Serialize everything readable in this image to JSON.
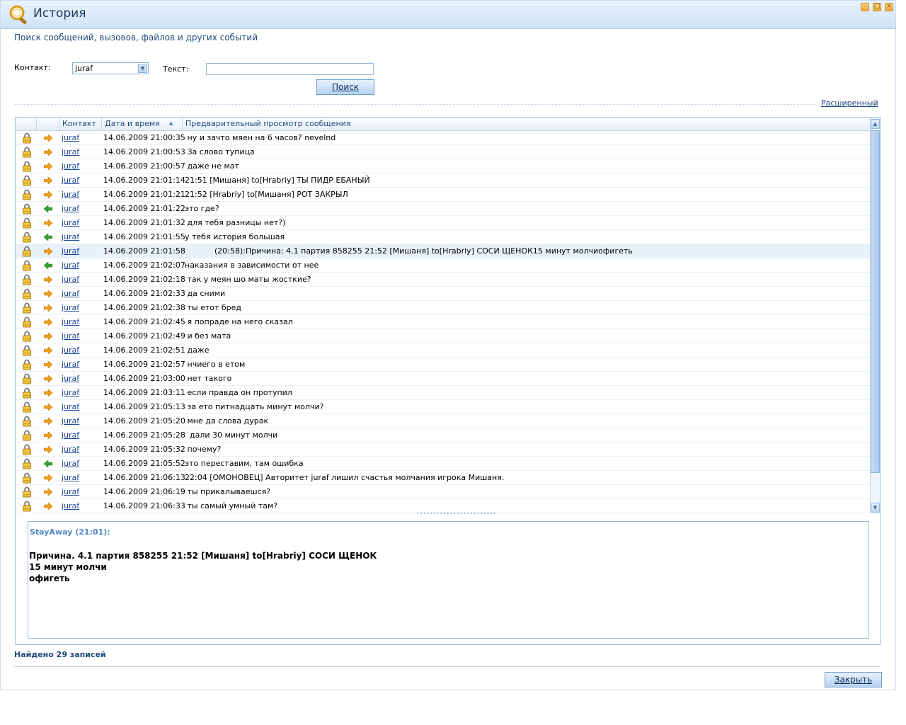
{
  "window": {
    "title": "История"
  },
  "search": {
    "subtitle": "Поиск сообщений, вызовов, файлов и других событий",
    "contact_label": "Контакт:",
    "contact_value": "juraf",
    "text_label": "Текст:",
    "text_value": "",
    "search_button": "Поиск",
    "advanced_link": "Расширенный"
  },
  "table": {
    "columns": [
      "",
      "",
      "Контакт",
      "Дата и время",
      "Предварительный просмотр сообщения"
    ],
    "rows": [
      {
        "dir": "out",
        "contact": "juraf",
        "date": "14.06.2009 21:00:35",
        "msg": " ну и зачто мяен на 6 часов? nevelnd"
      },
      {
        "dir": "out",
        "contact": "juraf",
        "date": "14.06.2009 21:00:53",
        "msg": " За слово тупица"
      },
      {
        "dir": "out",
        "contact": "juraf",
        "date": "14.06.2009 21:00:57",
        "msg": " даже не мат"
      },
      {
        "dir": "out",
        "contact": "juraf",
        "date": "14.06.2009 21:01:14",
        "msg": "21:51 [Мишаня] to[Hrabriy] ТЫ ПИДР ЕБАНЫЙ"
      },
      {
        "dir": "out",
        "contact": "juraf",
        "date": "14.06.2009 21:01:21",
        "msg": "21:52 [Hrabriy] to[Мишаня] РОТ ЗАКРЫЛ"
      },
      {
        "dir": "in",
        "contact": "juraf",
        "date": "14.06.2009 21:01:22",
        "msg": "это где?"
      },
      {
        "dir": "out",
        "contact": "juraf",
        "date": "14.06.2009 21:01:32",
        "msg": " для тебя разницы нет?)"
      },
      {
        "dir": "in",
        "contact": "juraf",
        "date": "14.06.2009 21:01:55",
        "msg": "у тебя история большая"
      },
      {
        "dir": "out",
        "contact": "juraf",
        "date": "14.06.2009 21:01:58",
        "msg": "            (20:58):Причина: 4.1 партия 858255 21:52 [Мишаня] to[Hrabriy] СОСИ ЩЕНОК15 минут молчиофигеть",
        "selected": true
      },
      {
        "dir": "in",
        "contact": "juraf",
        "date": "14.06.2009 21:02:07",
        "msg": "наказания в зависимости от нее"
      },
      {
        "dir": "out",
        "contact": "juraf",
        "date": "14.06.2009 21:02:18",
        "msg": " так у меян шо маты жосткие?"
      },
      {
        "dir": "out",
        "contact": "juraf",
        "date": "14.06.2009 21:02:33",
        "msg": " да сними"
      },
      {
        "dir": "out",
        "contact": "juraf",
        "date": "14.06.2009 21:02:38",
        "msg": " ты етот бред"
      },
      {
        "dir": "out",
        "contact": "juraf",
        "date": "14.06.2009 21:02:45",
        "msg": " я попраде на него сказал"
      },
      {
        "dir": "out",
        "contact": "juraf",
        "date": "14.06.2009 21:02:49",
        "msg": " и без мата"
      },
      {
        "dir": "out",
        "contact": "juraf",
        "date": "14.06.2009 21:02:51",
        "msg": " даже"
      },
      {
        "dir": "out",
        "contact": "juraf",
        "date": "14.06.2009 21:02:57",
        "msg": " нчиего в етом"
      },
      {
        "dir": "out",
        "contact": "juraf",
        "date": "14.06.2009 21:03:00",
        "msg": " нет такого"
      },
      {
        "dir": "out",
        "contact": "juraf",
        "date": "14.06.2009 21:03:11",
        "msg": " если правда он протупил"
      },
      {
        "dir": "out",
        "contact": "juraf",
        "date": "14.06.2009 21:05:13",
        "msg": " за ето питнадцать минут молчи?"
      },
      {
        "dir": "out",
        "contact": "juraf",
        "date": "14.06.2009 21:05:20",
        "msg": " мне да слова дурак"
      },
      {
        "dir": "out",
        "contact": "juraf",
        "date": "14.06.2009 21:05:28",
        "msg": "  дали 30 минут молчи"
      },
      {
        "dir": "out",
        "contact": "juraf",
        "date": "14.06.2009 21:05:32",
        "msg": " почему?"
      },
      {
        "dir": "in",
        "contact": "juraf",
        "date": "14.06.2009 21:05:52",
        "msg": "это переставим, там ошибка"
      },
      {
        "dir": "out",
        "contact": "juraf",
        "date": "14.06.2009 21:06:13",
        "msg": "22:04 [ОМОНОВЕЦ] Авторитет juraf лишил счастья молчания игрока Мишаня."
      },
      {
        "dir": "out",
        "contact": "juraf",
        "date": "14.06.2009 21:06:19",
        "msg": " ты прикалываешся?"
      },
      {
        "dir": "out",
        "contact": "juraf",
        "date": "14.06.2009 21:06:33",
        "msg": " ты самый умный там?"
      }
    ]
  },
  "preview": {
    "header": "StayAway (21:01):",
    "body": "Причина. 4.1 партия 858255 21:52 [Мишаня] to[Hrabriy] СОСИ ЩЕНОК\n15 минут молчи\nофигеть"
  },
  "status": {
    "found": "Найдено 29 записей"
  },
  "footer": {
    "close_button": "Закрыть"
  },
  "colors": {
    "accent": "#1f4a7a",
    "link": "#1f4a9c",
    "preview_header": "#4f88c6",
    "arrow_out": "#f0a020",
    "arrow_in": "#3aa23a",
    "selected_row": "#e8f0fa"
  },
  "icons": {
    "title": "search-magnifier-icon",
    "row_status": "lock-icon",
    "dir_out": "arrow-right-icon",
    "dir_in": "arrow-left-icon"
  }
}
